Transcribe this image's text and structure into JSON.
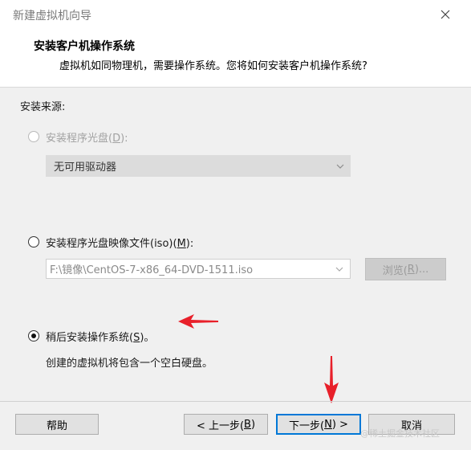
{
  "window": {
    "title": "新建虚拟机向导"
  },
  "header": {
    "title": "安装客户机操作系统",
    "subtitle": "虚拟机如同物理机，需要操作系统。您将如何安装客户机操作系统?"
  },
  "install_source": {
    "label": "安装来源:",
    "option_disc": {
      "label": "安装程序光盘(",
      "hotkey": "D",
      "suffix": "):",
      "selected": false,
      "enabled": false
    },
    "drive_dropdown": {
      "value": "无可用驱动器"
    },
    "option_iso": {
      "label": "安装程序光盘映像文件(iso)(",
      "hotkey": "M",
      "suffix": "):",
      "selected": false
    },
    "iso_path": {
      "value": "F:\\镜像\\CentOS-7-x86_64-DVD-1511.iso"
    },
    "browse_button": {
      "label": "浏览(",
      "hotkey": "R",
      "suffix": ")..."
    },
    "option_later": {
      "label": "稍后安装操作系统(",
      "hotkey": "S",
      "suffix": ")。",
      "selected": true
    },
    "later_description": "创建的虚拟机将包含一个空白硬盘。"
  },
  "footer": {
    "help": "帮助",
    "back": {
      "label": "< 上一步(",
      "hotkey": "B",
      "suffix": ")"
    },
    "next": {
      "label": "下一步(",
      "hotkey": "N",
      "suffix": ") >"
    },
    "cancel": "取消",
    "watermark": "@稀土掘金技术社区"
  },
  "annotations": {
    "arrow_color": "#e8202a"
  },
  "icons": [
    "close-icon",
    "chevron-down-icon",
    "red-arrow-left-icon",
    "red-arrow-down-icon"
  ]
}
